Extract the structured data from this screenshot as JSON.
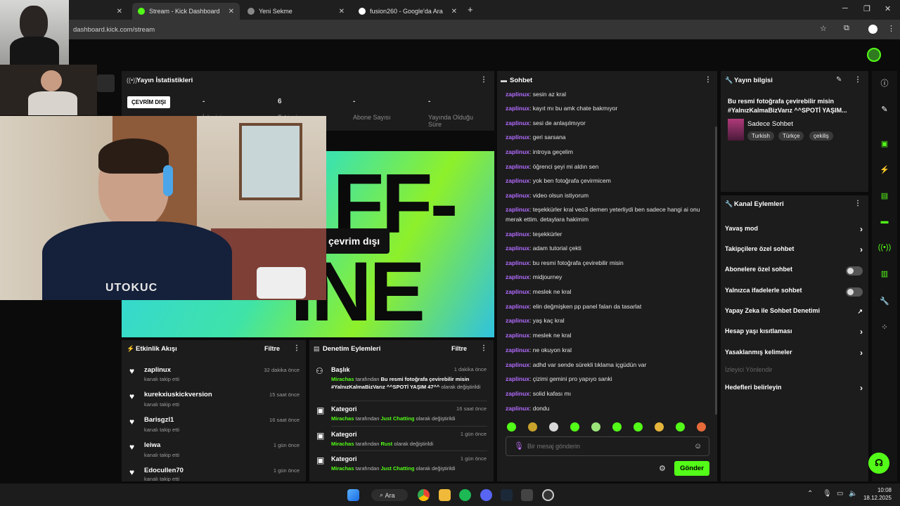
{
  "browser": {
    "tabs": [
      {
        "title": "Stream - Kick Dashboard",
        "active": true
      },
      {
        "title": "Yeni Sekme",
        "active": false
      },
      {
        "title": "fusion260 - Google'da Ara",
        "active": false
      }
    ],
    "url": "dashboard.kick.com/stream"
  },
  "stats": {
    "title": "Yayın İstatistikleri",
    "status_badge": "ÇEVRİM DIŞI",
    "items": [
      {
        "value": "-",
        "label": "İzleyici"
      },
      {
        "value": "6",
        "label": "Takipçi"
      },
      {
        "value": "-",
        "label": "Abone Sayısı"
      },
      {
        "value": "-",
        "label": "Yayında Olduğu Süre"
      }
    ]
  },
  "preview": {
    "overlay_text": "çevrim dışı",
    "big_text_1": "FF-",
    "big_text_2": "INE"
  },
  "activity": {
    "title": "Etkinlik Akışı",
    "filter_label": "Filtre",
    "items": [
      {
        "name": "zaplinux",
        "sub": "kanalı takip etti",
        "time": "32 dakika önce"
      },
      {
        "name": "kurekxiuskickversion",
        "sub": "kanalı takip etti",
        "time": "15 saat önce"
      },
      {
        "name": "Barisgzl1",
        "sub": "kanalı takip etti",
        "time": "16 saat önce"
      },
      {
        "name": "leiwa",
        "sub": "kanalı takip etti",
        "time": "1 gün önce"
      },
      {
        "name": "Edocullen70",
        "sub": "kanalı takip etti",
        "time": "1 gün önce"
      }
    ]
  },
  "moderation": {
    "title": "Denetim Eylemleri",
    "filter_label": "Filtre",
    "items": [
      {
        "title": "Başlık",
        "time": "1 dakika önce",
        "actor": "Mirachas",
        "mid": "tarafından",
        "value": "Bu resmi fotoğrafa çevirebilir misin #YalnızKalmaBizVarız ^^SPOTİ YAŞIM 47^^",
        "end": "olarak değiştirildi"
      },
      {
        "title": "Kategori",
        "time": "16 saat önce",
        "actor": "Mirachas",
        "mid": "tarafından",
        "value": "Just Chatting",
        "end": "olarak değiştirildi"
      },
      {
        "title": "Kategori",
        "time": "1 gün önce",
        "actor": "Mirachas",
        "mid": "tarafından",
        "value": "Rust",
        "end": "olarak değiştirildi"
      },
      {
        "title": "Kategori",
        "time": "1 gün önce",
        "actor": "Mirachas",
        "mid": "tarafından",
        "value": "Just Chatting",
        "end": "olarak değiştirildi"
      }
    ]
  },
  "chat": {
    "title": "Sohbet",
    "messages": [
      {
        "user": "zaplinux",
        "text": "sesin az kral"
      },
      {
        "user": "zaplinux",
        "text": "kayıt mı bu amk chate bakmıyor"
      },
      {
        "user": "zaplinux",
        "text": "sesi de anlaşılmıyor"
      },
      {
        "user": "zaplinux",
        "text": "geri sarsana"
      },
      {
        "user": "zaplinux",
        "text": "introya geçelim"
      },
      {
        "user": "zaplinux",
        "text": "öğrenci şeyi mi aldın sen"
      },
      {
        "user": "zaplinux",
        "text": "yok ben fotoğrafa çevirmicem"
      },
      {
        "user": "zaplinux",
        "text": "video olsun istiyorum"
      },
      {
        "user": "zaplinux",
        "text": "teşekkürler kral veo3 demen yeterliydi ben sadece hangi ai onu merak ettim. detaylara hakimim"
      },
      {
        "user": "zaplinux",
        "text": "teşekkürler"
      },
      {
        "user": "zaplinux",
        "text": "adam tutorial çekti"
      },
      {
        "user": "zaplinux",
        "text": "bu resmi fotoğrafa çevirebilir misin"
      },
      {
        "user": "zaplinux",
        "text": "midjourney"
      },
      {
        "user": "zaplinux",
        "text": "meslek ne kral"
      },
      {
        "user": "zaplinux",
        "text": "elin değmişken pp panel falan da tasarlat"
      },
      {
        "user": "zaplinux",
        "text": "yaş kaç kral"
      },
      {
        "user": "zaplinux",
        "text": "meslek ne kral"
      },
      {
        "user": "zaplinux",
        "text": "ne okuyon kral"
      },
      {
        "user": "zaplinux",
        "text": "adhd var sende sürekli tıklama içgüdün var"
      },
      {
        "user": "zaplinux",
        "text": "çizimi gemini pro yapıyo sanki"
      },
      {
        "user": "zaplinux",
        "text": "solid kafası mı"
      },
      {
        "user": "zaplinux",
        "text": "dondu"
      }
    ],
    "input_placeholder": "Bir mesaj gönderin",
    "send_label": "Gönder"
  },
  "stream_info": {
    "title": "Yayın bilgisi",
    "stream_title": "Bu resmi fotoğrafa çevirebilir misin #YalnızKalmaBizVarız ^^SPOTİ YAŞIM...",
    "category": "Sadece Sohbet",
    "tags": [
      "Turkish",
      "Türkçe",
      "çekiliş"
    ]
  },
  "channel_actions": {
    "title": "Kanal Eylemleri",
    "items": [
      {
        "label": "Yavaş mod",
        "control": "chevron"
      },
      {
        "label": "Takipçilere özel sohbet",
        "control": "chevron"
      },
      {
        "label": "Abonelere özel sohbet",
        "control": "toggle"
      },
      {
        "label": "Yalnızca ifadelerle sohbet",
        "control": "toggle"
      },
      {
        "label": "Yapay Zeka ile Sohbet Denetimi",
        "control": "external"
      },
      {
        "label": "Hesap yaşı kısıtlaması",
        "control": "chevron"
      },
      {
        "label": "Yasaklanmış kelimeler",
        "control": "chevron"
      },
      {
        "label": "İzleyici Yönlendir",
        "control": "none"
      },
      {
        "label": "Hedefleri belirleyin",
        "control": "chevron"
      }
    ]
  },
  "taskbar": {
    "search_label": "Ara",
    "time": "10:08",
    "date": "18.12.2025"
  },
  "colors": {
    "accent": "#53fc18",
    "username": "#b26bff",
    "panel": "#1c1c1c"
  }
}
